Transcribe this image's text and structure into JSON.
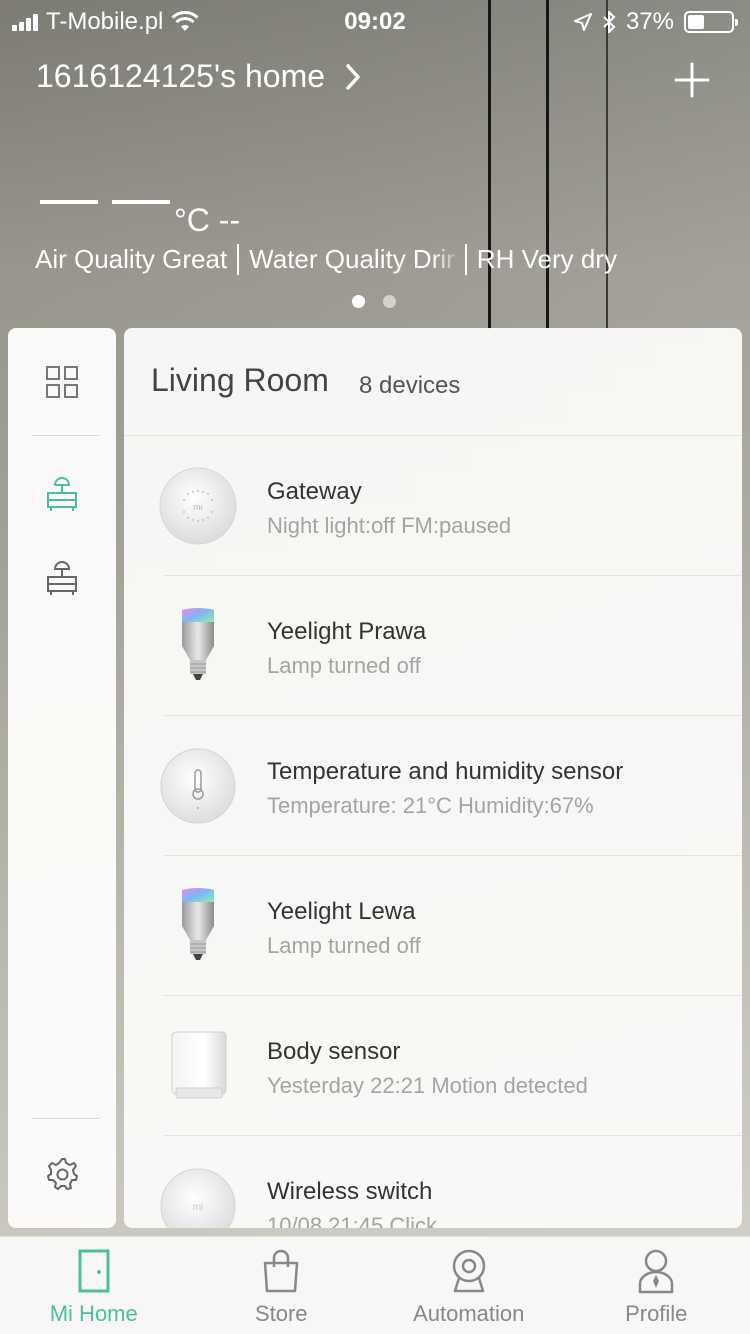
{
  "status_bar": {
    "carrier": "T-Mobile.pl",
    "time": "09:02",
    "battery": "37%",
    "battery_level": 0.37
  },
  "header": {
    "home_name": "1616124125's home",
    "temperature_unit": "°C --",
    "environment": [
      "Air Quality Great",
      "Water Quality Drir",
      "RH Very dry"
    ],
    "page_dots": 2,
    "active_page": 0
  },
  "sidebar": {
    "items": [
      "grid-icon",
      "living-room-icon",
      "bedroom-icon",
      "settings-icon"
    ]
  },
  "room": {
    "name": "Living Room",
    "device_count": "8 devices",
    "devices": [
      {
        "name": "Gateway",
        "status": "Night light:off FM:paused",
        "icon": "gateway-icon"
      },
      {
        "name": "Yeelight Prawa",
        "status": "Lamp turned off",
        "icon": "bulb-icon"
      },
      {
        "name": "Temperature and humidity sensor",
        "status": "Temperature: 21°C Humidity:67%",
        "icon": "thermometer-sensor-icon"
      },
      {
        "name": "Yeelight Lewa",
        "status": "Lamp turned off",
        "icon": "bulb-icon"
      },
      {
        "name": "Body sensor",
        "status": "Yesterday 22:21 Motion detected",
        "icon": "motion-sensor-icon"
      },
      {
        "name": "Wireless switch",
        "status": "10/08 21:45 Click",
        "icon": "switch-icon"
      }
    ]
  },
  "tabbar": {
    "tabs": [
      {
        "label": "Mi Home",
        "active": true
      },
      {
        "label": "Store",
        "active": false
      },
      {
        "label": "Automation",
        "active": false
      },
      {
        "label": "Profile",
        "active": false
      }
    ],
    "accent_color": "#4dbf98"
  }
}
